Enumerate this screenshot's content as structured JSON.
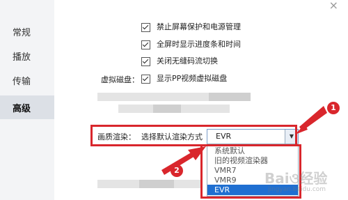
{
  "sidebar": {
    "items": [
      {
        "label": "常规"
      },
      {
        "label": "播放"
      },
      {
        "label": "传输"
      },
      {
        "label": "高级"
      }
    ]
  },
  "window": {
    "close_label": "×"
  },
  "options": [
    {
      "label": "禁止屏幕保护和电源管理",
      "checked": true
    },
    {
      "label": "全屏时显示进度条和时间",
      "checked": true
    },
    {
      "label": "关闭无缝码流切换",
      "checked": true
    },
    {
      "label": "显示PP视频虚拟磁盘",
      "checked": true
    }
  ],
  "virtual_disk_label": "虚拟磁盘：",
  "render": {
    "section_label": "画质渲染：",
    "select_label": "选择默认渲染方式",
    "selected_value": "EVR",
    "dropdown_items": [
      "系统默认",
      "旧的视频渲染器",
      "VMR7",
      "VMR9",
      "EVR"
    ]
  },
  "annotations": {
    "badge1": "1",
    "badge2": "2"
  },
  "watermark": {
    "main": "Baiও经验",
    "sub": "jingyan.baidu.com"
  },
  "colors": {
    "highlight": "#1f6fd1",
    "annotation": "#d9262c"
  }
}
